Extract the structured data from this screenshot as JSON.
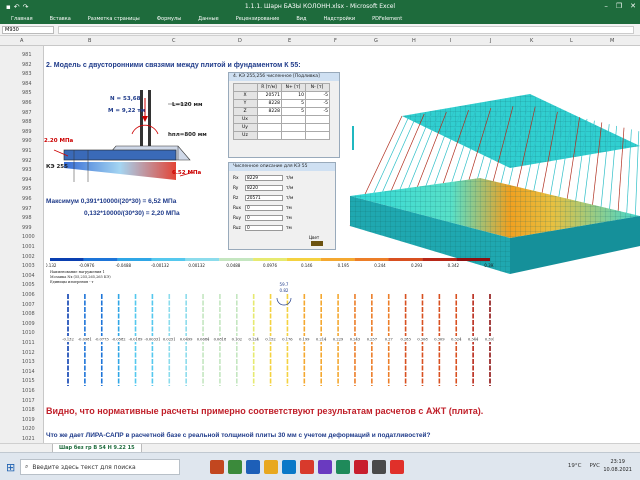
{
  "window": {
    "title": "1.1.1. Шарн БАЗЫ КОЛОНН.xlsx - Microsoft Excel",
    "qat_icons": [
      "save-icon",
      "undo-icon",
      "redo-icon"
    ],
    "controls": {
      "minimize": "–",
      "restore": "❐",
      "close": "✕"
    }
  },
  "ribbon_tabs": [
    "Главная",
    "Вставка",
    "Разметка страницы",
    "Формулы",
    "Данные",
    "Рецензирование",
    "Вид",
    "Надстройки",
    "PDFelement"
  ],
  "formula_bar": {
    "name_box": "M930",
    "formula": ""
  },
  "columns": [
    "A",
    "B",
    "C",
    "D",
    "E",
    "F",
    "G",
    "H",
    "I",
    "J",
    "K",
    "L",
    "M"
  ],
  "rows": [
    "981",
    "982",
    "983",
    "984",
    "985",
    "986",
    "987",
    "988",
    "989",
    "990",
    "991",
    "992",
    "993",
    "994",
    "995",
    "996",
    "997",
    "998",
    "999",
    "1000",
    "1001",
    "1002",
    "1003",
    "1004",
    "1005",
    "1006",
    "1007",
    "1008",
    "1009",
    "1010",
    "1011",
    "1012",
    "1013",
    "1014",
    "1015",
    "1016",
    "1017",
    "1018",
    "1019",
    "1020",
    "1021"
  ],
  "sheet": {
    "heading": "2. Модель с двусторонними связями между плитой и фундаментом К 55:",
    "sketch": {
      "n_label": "N = 53,68",
      "m_label": "M = 9,22 тм",
      "l_label": "L=120 мм",
      "h_label": "hпл=800 мм",
      "p_left": "2.20 МПа",
      "p_right": "6.52 МПа",
      "ke_label": "КЭ 255"
    },
    "max_line1": "Максимум 0,391*10000/(20*30) = 6,52 МПа",
    "max_line2": "0,132*10000/(30*30) = 2,20 МПа",
    "note1": "Видно, что нормативные расчеты примерно соответствуют результатам расчетов с АЖТ (плита).",
    "note2": "Что же дает ЛИРА-САПР в расчетной базе с реальной толщиной плиты 30 мм с учетом деформаций и податливостей?"
  },
  "win1": {
    "title": "4. КЭ 255,256 численное [Подливка]",
    "headers": [
      "",
      "R [т/м]",
      "N+ [т]",
      "N- [т]"
    ],
    "rows": [
      [
        "X",
        "20571",
        "10",
        "-5"
      ],
      [
        "Y",
        "8228",
        "5",
        "-5"
      ],
      [
        "Z",
        "8228",
        "5",
        "-5"
      ],
      [
        "Ux",
        "",
        "",
        ""
      ],
      [
        "Uy",
        "",
        "",
        ""
      ],
      [
        "Uz",
        "",
        "",
        ""
      ]
    ]
  },
  "win2": {
    "title": "Численное описание для КЭ 55",
    "fields": [
      {
        "label": "Rx",
        "value": "8229",
        "unit": "т/м"
      },
      {
        "label": "Ry",
        "value": "8220",
        "unit": "т/м"
      },
      {
        "label": "Rz",
        "value": "20571",
        "unit": "т/м"
      },
      {
        "label": "Rux",
        "value": "0",
        "unit": "тм"
      },
      {
        "label": "Ruy",
        "value": "0",
        "unit": "тм"
      },
      {
        "label": "Ruz",
        "value": "0",
        "unit": "тм"
      }
    ],
    "color_label": "Цвет",
    "color_swatch": "#6b5210"
  },
  "chart_data": {
    "type": "bar",
    "scale_ticks": [
      "-0.132",
      "-0.0976",
      "-0.0488",
      "-0.00132",
      "0.00132",
      "0.0488",
      "0.0976",
      "0.146",
      "0.195",
      "0.244",
      "0.293",
      "0.342",
      "0.391"
    ],
    "scale_colors": [
      "#0a3fb0",
      "#1d74d8",
      "#2fa6e6",
      "#55c8ee",
      "#8cdcec",
      "#c4e6c0",
      "#e6ea70",
      "#f4d240",
      "#f4a830",
      "#ec7e28",
      "#d85020",
      "#b82818",
      "#8e1010"
    ],
    "legend_lines": [
      "Наименование нагружения 1",
      "Мозаика Nx (55,255,265,265 КЭ)",
      "Единицы измерения - т"
    ],
    "annotation": {
      "top": "59.7",
      "bottom": "0.82"
    },
    "values": [
      -0.132,
      -0.0981,
      -0.0773,
      -0.0582,
      -0.0189,
      -0.00331,
      0.0251,
      0.0499,
      0.0684,
      0.0818,
      0.102,
      0.124,
      0.152,
      0.176,
      0.199,
      0.214,
      0.229,
      0.243,
      0.257,
      0.27,
      0.283,
      0.308,
      0.309,
      0.324,
      0.344,
      0.391
    ],
    "labels": [
      "-0.132",
      "-0.0981",
      "-0.0773",
      "-0.0582",
      "-0.0189",
      "-0.00331",
      "0.0251",
      "0.0499",
      "0.0684",
      "0.0818",
      "0.102",
      "0.124",
      "0.152",
      "0.176",
      "0.199",
      "0.214",
      "0.229",
      "0.243",
      "0.257",
      "0.27",
      "0.283",
      "0.308",
      "0.309",
      "0.324",
      "0.344",
      "0.391"
    ]
  },
  "status_bar": {
    "sheet_tab": "Шар без гр В 54 Н 9.22 15"
  },
  "taskbar": {
    "search_placeholder": "Введите здесь текст для поиска",
    "weather": "19°C",
    "lang": "РУС",
    "time": "23:19",
    "date": "10.08.2021"
  }
}
